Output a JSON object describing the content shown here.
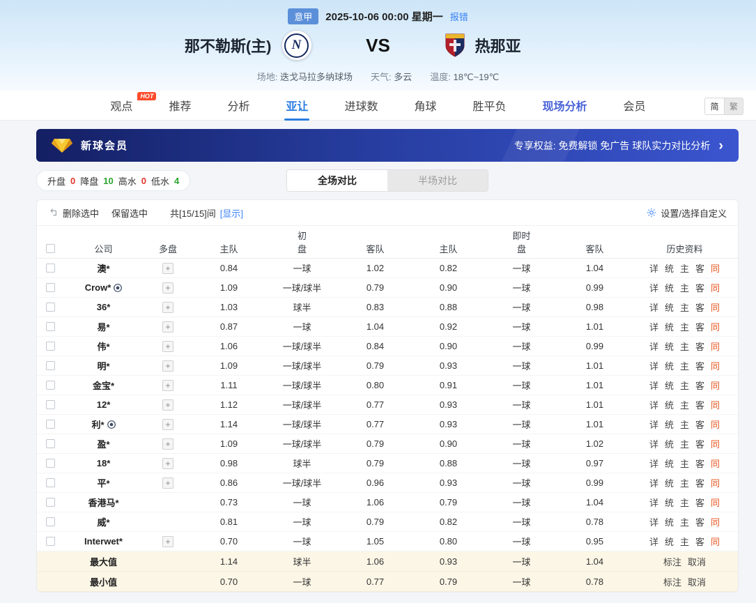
{
  "header": {
    "league": "意甲",
    "datetime": "2025-10-06 00:00 星期一",
    "report": "报错",
    "home": {
      "name": "那不勒斯(主)",
      "logo_letter": "N"
    },
    "vs": "VS",
    "away": {
      "name": "热那亚"
    },
    "info": [
      {
        "label": "场地:",
        "value": "迭戈马拉多纳球场"
      },
      {
        "label": "天气:",
        "value": "多云"
      },
      {
        "label": "温度:",
        "value": "18℃~19℃"
      }
    ]
  },
  "nav": {
    "tabs": [
      {
        "label": "观点",
        "hot": "HOT"
      },
      {
        "label": "推荐"
      },
      {
        "label": "分析"
      },
      {
        "label": "亚让",
        "active": true
      },
      {
        "label": "进球数"
      },
      {
        "label": "角球"
      },
      {
        "label": "胜平负"
      },
      {
        "label": "现场分析",
        "highlight": true
      },
      {
        "label": "会员"
      }
    ],
    "lang": [
      "简",
      "繁"
    ]
  },
  "promo": {
    "title": "新球会员",
    "benefits": "专享权益: 免费解锁 免广告 球队实力对比分析",
    "arrow": "›"
  },
  "stats": [
    {
      "label": "升盘",
      "value": "0",
      "color": "#e5372c"
    },
    {
      "label": "降盘",
      "value": "10",
      "color": "#2ba52f"
    },
    {
      "label": "高水",
      "value": "0",
      "color": "#e5372c"
    },
    {
      "label": "低水",
      "value": "4",
      "color": "#2ba52f"
    }
  ],
  "view_tabs": [
    {
      "label": "全场对比",
      "active": true
    },
    {
      "label": "半场对比",
      "active": false
    }
  ],
  "toolbar": {
    "delete": "删除选中",
    "keep": "保留选中",
    "count": "共[15/15]间",
    "show": "[显示]",
    "settings": "设置/选择自定义"
  },
  "table": {
    "head": {
      "company": "公司",
      "multi": "多盘",
      "initial": "初",
      "live": "即时",
      "home": "主队",
      "pan": "盘",
      "away": "客队",
      "history": "历史资料"
    },
    "links": [
      {
        "key": "detail",
        "label": "详"
      },
      {
        "key": "stats",
        "label": "统"
      },
      {
        "key": "home",
        "label": "主"
      },
      {
        "key": "away",
        "label": "客"
      },
      {
        "key": "same",
        "label": "同",
        "accent": true
      }
    ],
    "rows": [
      {
        "company": "澳*",
        "multi": true,
        "ball": false,
        "init": [
          "0.84",
          "一球",
          "1.02"
        ],
        "live": [
          "0.82",
          "一球",
          "1.04"
        ]
      },
      {
        "company": "Crow*",
        "multi": true,
        "ball": true,
        "init": [
          "1.09",
          "一球/球半",
          "0.79"
        ],
        "live": [
          "0.90",
          "一球",
          "0.99"
        ]
      },
      {
        "company": "36*",
        "multi": true,
        "ball": false,
        "init": [
          "1.03",
          "球半",
          "0.83"
        ],
        "live": [
          "0.88",
          "一球",
          "0.98"
        ]
      },
      {
        "company": "易*",
        "multi": true,
        "ball": false,
        "init": [
          "0.87",
          "一球",
          "1.04"
        ],
        "live": [
          "0.92",
          "一球",
          "1.01"
        ]
      },
      {
        "company": "伟*",
        "multi": true,
        "ball": false,
        "init": [
          "1.06",
          "一球/球半",
          "0.84"
        ],
        "live": [
          "0.90",
          "一球",
          "0.99"
        ]
      },
      {
        "company": "明*",
        "multi": true,
        "ball": false,
        "init": [
          "1.09",
          "一球/球半",
          "0.79"
        ],
        "live": [
          "0.93",
          "一球",
          "1.01"
        ]
      },
      {
        "company": "金宝*",
        "multi": true,
        "ball": false,
        "init": [
          "1.11",
          "一球/球半",
          "0.80"
        ],
        "live": [
          "0.91",
          "一球",
          "1.01"
        ]
      },
      {
        "company": "12*",
        "multi": true,
        "ball": false,
        "init": [
          "1.12",
          "一球/球半",
          "0.77"
        ],
        "live": [
          "0.93",
          "一球",
          "1.01"
        ]
      },
      {
        "company": "利*",
        "multi": true,
        "ball": true,
        "init": [
          "1.14",
          "一球/球半",
          "0.77"
        ],
        "live": [
          "0.93",
          "一球",
          "1.01"
        ]
      },
      {
        "company": "盈*",
        "multi": true,
        "ball": false,
        "init": [
          "1.09",
          "一球/球半",
          "0.79"
        ],
        "live": [
          "0.90",
          "一球",
          "1.02"
        ]
      },
      {
        "company": "18*",
        "multi": true,
        "ball": false,
        "init": [
          "0.98",
          "球半",
          "0.79"
        ],
        "live": [
          "0.88",
          "一球",
          "0.97"
        ]
      },
      {
        "company": "平*",
        "multi": true,
        "ball": false,
        "init": [
          "0.86",
          "一球/球半",
          "0.96"
        ],
        "live": [
          "0.93",
          "一球",
          "0.99"
        ]
      },
      {
        "company": "香港马*",
        "multi": false,
        "ball": false,
        "init": [
          "0.73",
          "一球",
          "1.06"
        ],
        "live": [
          "0.79",
          "一球",
          "1.04"
        ]
      },
      {
        "company": "威*",
        "multi": false,
        "ball": false,
        "init": [
          "0.81",
          "一球",
          "0.79"
        ],
        "live": [
          "0.82",
          "一球",
          "0.78"
        ]
      },
      {
        "company": "Interwet*",
        "multi": true,
        "ball": false,
        "init": [
          "0.70",
          "一球",
          "1.05"
        ],
        "live": [
          "0.80",
          "一球",
          "0.95"
        ]
      }
    ],
    "summary": [
      {
        "label": "最大值",
        "init": [
          "1.14",
          "球半",
          "1.06"
        ],
        "live": [
          "0.93",
          "一球",
          "1.04"
        ],
        "actions": [
          "标注",
          "取消"
        ]
      },
      {
        "label": "最小值",
        "init": [
          "0.70",
          "一球",
          "0.77"
        ],
        "live": [
          "0.79",
          "一球",
          "0.78"
        ],
        "actions": [
          "标注",
          "取消"
        ]
      }
    ]
  },
  "colors": {
    "accent_blue": "#2b7de0",
    "link_blue": "#3b82f6",
    "accent_orange": "#e8541e",
    "up_red": "#e5372c",
    "down_green": "#2ba52f"
  }
}
